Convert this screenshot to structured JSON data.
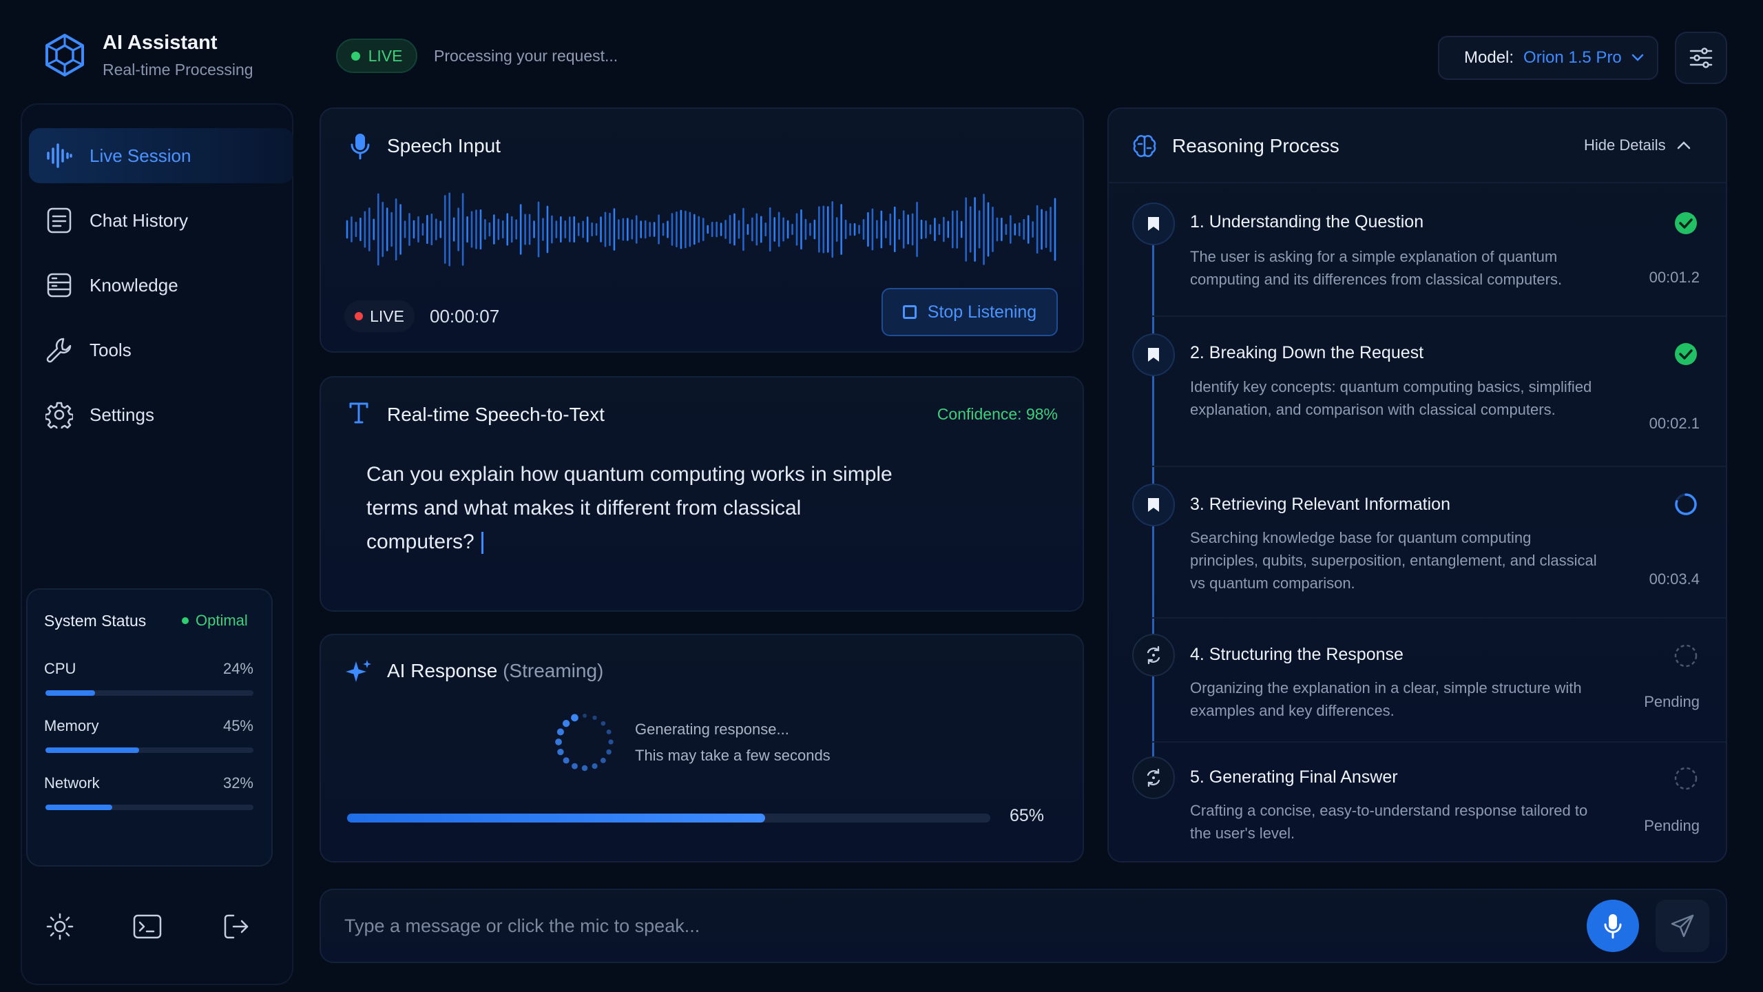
{
  "brand": {
    "title": "AI Assistant",
    "subtitle": "Real-time Processing",
    "icon": "hexagon-cube-icon"
  },
  "header": {
    "live_label": "LIVE",
    "status_text": "Processing your request...",
    "model_label": "Model:",
    "model_value": "Orion 1.5 Pro",
    "settings_icon": "sliders-icon"
  },
  "sidebar": {
    "items": [
      {
        "label": "Live Session",
        "icon": "waveform-icon",
        "active": true
      },
      {
        "label": "Chat History",
        "icon": "document-icon"
      },
      {
        "label": "Knowledge",
        "icon": "database-icon"
      },
      {
        "label": "Tools",
        "icon": "wrench-icon"
      },
      {
        "label": "Settings",
        "icon": "gear-icon"
      }
    ],
    "system_status": {
      "title": "System Status",
      "state": "Optimal",
      "metrics": [
        {
          "name": "CPU",
          "value": "24%",
          "fraction": 0.24
        },
        {
          "name": "Memory",
          "value": "45%",
          "fraction": 0.45
        },
        {
          "name": "Network",
          "value": "32%",
          "fraction": 0.32
        }
      ]
    },
    "bottom_icons": [
      "sun-icon",
      "terminal-icon",
      "logout-icon"
    ]
  },
  "speech": {
    "title": "Speech Input",
    "live_label": "LIVE",
    "timer": "00:00:07",
    "stop_label": "Stop Listening"
  },
  "stt": {
    "title": "Real-time Speech-to-Text",
    "confidence": "Confidence: 98%",
    "transcript": "Can you explain how quantum computing works in simple terms and what makes it different from classical computers?"
  },
  "response": {
    "title": "AI Response",
    "streaming": "(Streaming)",
    "line1": "Generating response...",
    "line2": "This may take a few seconds",
    "progress_label": "65%",
    "progress": 0.65
  },
  "reasoning": {
    "title": "Reasoning Process",
    "toggle_label": "Hide Details",
    "steps": [
      {
        "title": "1. Understanding the Question",
        "desc": "The user is asking for a simple explanation of quantum computing and its differences from classical computers.",
        "time": "00:01.2",
        "status": "done"
      },
      {
        "title": "2. Breaking Down the Request",
        "desc": "Identify key concepts: quantum computing basics, simplified explanation, and comparison with classical computers.",
        "time": "00:02.1",
        "status": "done"
      },
      {
        "title": "3. Retrieving Relevant Information",
        "desc": "Searching knowledge base for quantum computing principles, qubits, superposition, entanglement, and classical vs quantum comparison.",
        "time": "00:03.4",
        "status": "running"
      },
      {
        "title": "4. Structuring the Response",
        "desc": "Organizing the explanation in a clear, simple structure with examples and key differences.",
        "time": "Pending",
        "status": "pending"
      },
      {
        "title": "5. Generating Final Answer",
        "desc": "Crafting a concise, easy-to-understand response tailored to the user's level.",
        "time": "Pending",
        "status": "pending"
      }
    ]
  },
  "composer": {
    "placeholder": "Type a message or click the mic to speak...",
    "mic_icon": "microphone-icon",
    "send_icon": "send-icon"
  },
  "colors": {
    "accent": "#3e8bff",
    "success": "#2fcf6f",
    "danger": "#f04444",
    "background": "#050d1b"
  }
}
